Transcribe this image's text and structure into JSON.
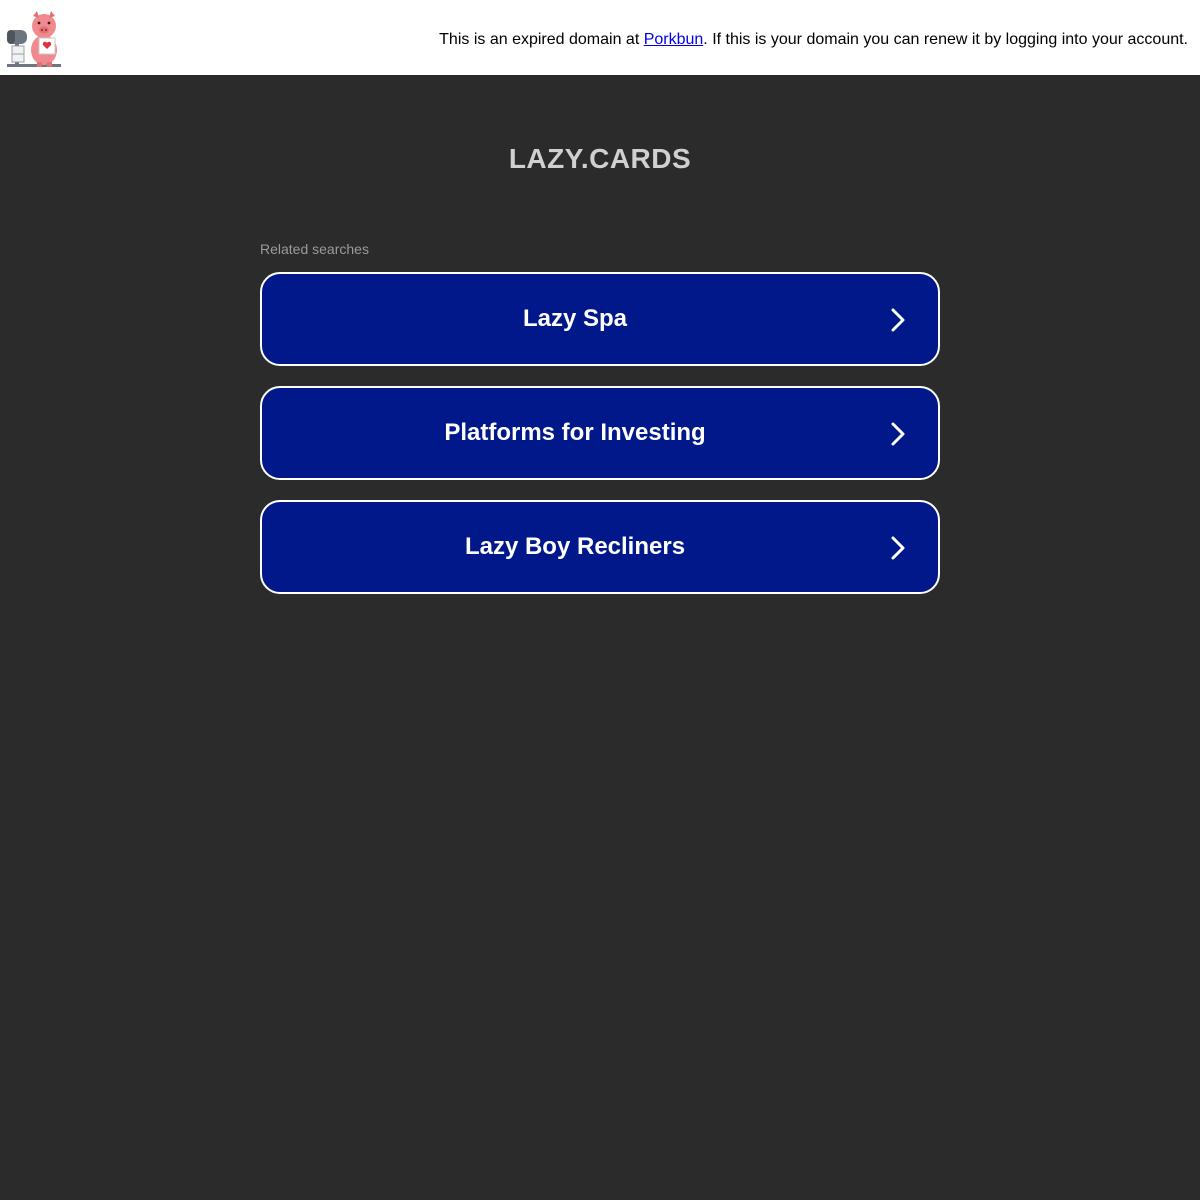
{
  "header": {
    "notice_prefix": "This is an expired domain at ",
    "registrar_link": "Porkbun",
    "notice_suffix": ". If this is your domain you can renew it by logging into your account."
  },
  "main": {
    "domain": "LAZY.CARDS",
    "related_label": "Related searches",
    "results": [
      {
        "label": "Lazy Spa"
      },
      {
        "label": "Platforms for Investing"
      },
      {
        "label": "Lazy Boy Recliners"
      }
    ]
  },
  "colors": {
    "background": "#2b2b2b",
    "button": "#00188a",
    "title": "#d0d0d0"
  },
  "icons": {
    "logo": "pig-mailbox-icon",
    "result_arrow": "chevron-right-icon"
  }
}
